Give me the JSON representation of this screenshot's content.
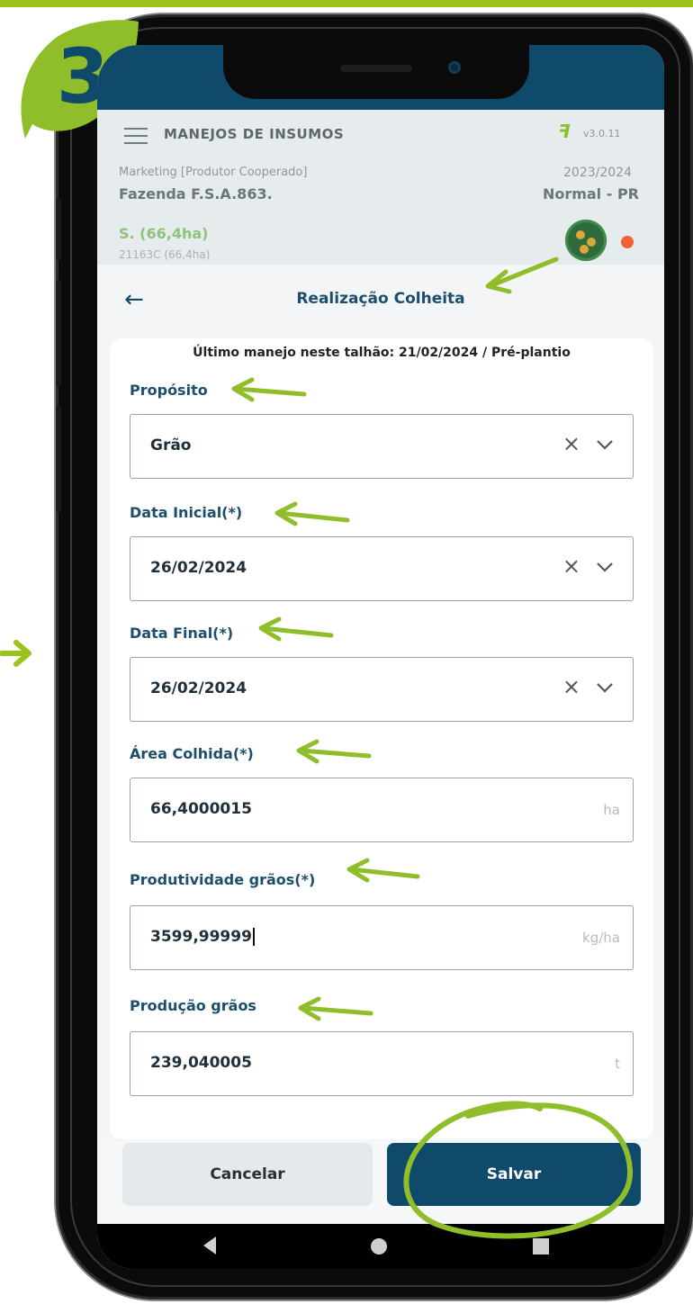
{
  "step": {
    "number": "3"
  },
  "colors": {
    "brand_green": "#9bc31c",
    "header_blue": "#0f4a6b",
    "status_dot": "#ee6236"
  },
  "header": {
    "title": "MANEJOS DE INSUMOS",
    "logo_icon": "app-logo-icon",
    "version": "v3.0.11",
    "role": "Marketing [Produtor Cooperado]",
    "farm": "Fazenda F.S.A.863.",
    "season": "2023/2024",
    "region": "Normal - PR",
    "area": "S. (66,4ha)",
    "area_detail": "21163C (66,4ha)"
  },
  "screen": {
    "title": "Realização Colheita"
  },
  "form": {
    "last_manejo": "Último manejo neste talhão: 21/02/2024 / Pré-plantio",
    "proposito": {
      "label": "Propósito",
      "value": "Grão"
    },
    "data_inicial": {
      "label": "Data Inicial(*)",
      "value": "26/02/2024"
    },
    "data_final": {
      "label": "Data Final(*)",
      "value": "26/02/2024"
    },
    "area_colhida": {
      "label": "Área Colhida(*)",
      "value": "66,4000015",
      "unit": "ha"
    },
    "produtividade": {
      "label": "Produtividade grãos(*)",
      "value": "3599,99999",
      "unit": "kg/ha"
    },
    "producao": {
      "label": "Produção grãos",
      "value": "239,040005",
      "unit": "t"
    }
  },
  "buttons": {
    "cancel": "Cancelar",
    "save": "Salvar"
  }
}
